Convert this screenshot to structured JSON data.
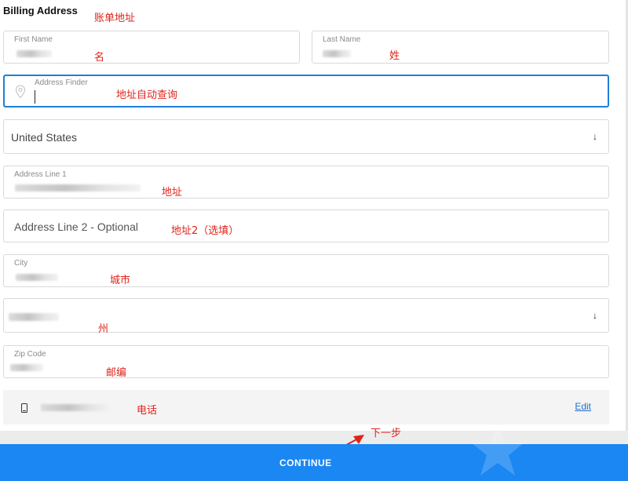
{
  "form": {
    "title": "Billing Address",
    "first_name": {
      "label": "First Name"
    },
    "last_name": {
      "label": "Last Name"
    },
    "address_finder": {
      "label": "Address Finder",
      "value": ""
    },
    "country": {
      "value": "United States",
      "arrow": "↓"
    },
    "address_line1": {
      "label": "Address Line 1"
    },
    "address_line2": {
      "placeholder": "Address Line 2 - Optional"
    },
    "city": {
      "label": "City"
    },
    "state": {
      "arrow": "↓"
    },
    "zip": {
      "label": "Zip Code"
    },
    "phone": {
      "edit_label": "Edit"
    },
    "continue_label": "CONTINUE"
  },
  "annotations": {
    "billing_address": "账单地址",
    "first_name": "名",
    "last_name": "姓",
    "address_finder": "地址自动查询",
    "address_line1": "地址",
    "address_line2": "地址2（选填）",
    "city": "城市",
    "state": "州",
    "zip": "邮编",
    "phone": "电话",
    "next_step": "下一步"
  },
  "icons": {
    "location": "location-pin-icon",
    "phone": "mobile-phone-icon",
    "dropdown": "arrow-down-icon"
  },
  "colors": {
    "accent": "#1a87f2",
    "focus_border": "#1e7fd8",
    "annotation": "#e0231b",
    "link": "#1e6fd2"
  }
}
